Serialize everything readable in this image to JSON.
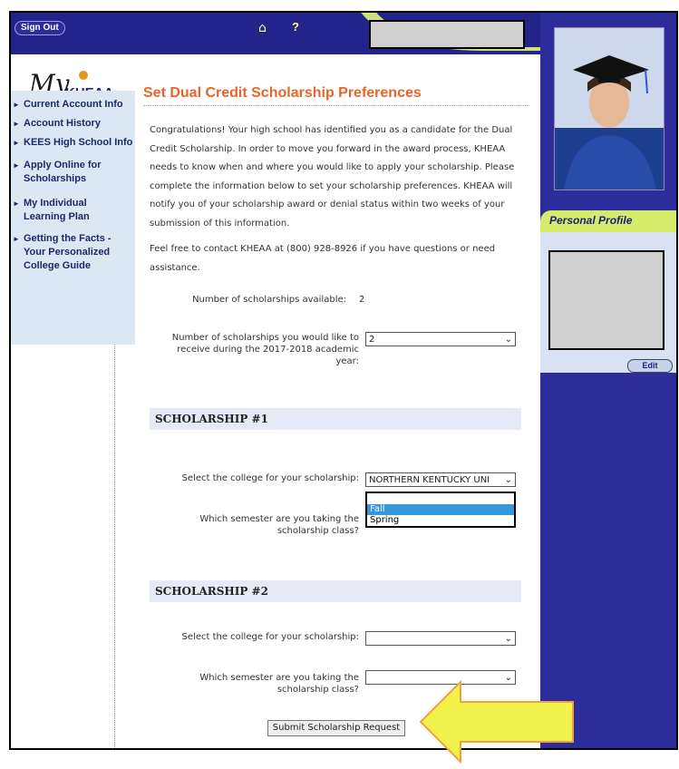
{
  "header": {
    "signout_label": "Sign Out",
    "help_label": "?",
    "home_icon": "home-icon"
  },
  "logo": {
    "text_my": "My",
    "text_kheaa": "KHEAA"
  },
  "nav": {
    "items": [
      {
        "label": "Current Account Info"
      },
      {
        "label": "Account History"
      },
      {
        "label": "KEES High School Info"
      },
      {
        "label": "Apply Online for Scholarships"
      },
      {
        "label": "My Individual Learning Plan"
      },
      {
        "label": "Getting the Facts - Your Personalized College Guide"
      }
    ]
  },
  "main": {
    "title": "Set Dual Credit Scholarship Preferences",
    "intro": "Congratulations! Your high school has identified you as a candidate for the Dual Credit Scholarship. In order to move you forward in the award process, KHEAA needs to know when and where you would like to apply your scholarship. Please complete the information below to set your scholarship preferences. KHEAA will notify you of your scholarship award or denial status within two weeks of your submission of this information.",
    "contact": "Feel free to contact KHEAA at (800) 928-8926 if you have questions or need assistance.",
    "available_label": "Number of scholarships available:",
    "available_value": "2",
    "receive_label": "Number of scholarships you would like to receive during the 2017-2018 academic year:",
    "receive_value": "2",
    "scholarship1": {
      "heading": "SCHOLARSHIP #1",
      "college_label": "Select the college for your scholarship:",
      "college_value": "NORTHERN KENTUCKY UNI",
      "semester_label": "Which semester are you taking the scholarship class?",
      "options": [
        "Fall",
        "Spring"
      ],
      "selected": "Fall"
    },
    "scholarship2": {
      "heading": "SCHOLARSHIP #2",
      "college_label": "Select the college for your scholarship:",
      "college_value": "",
      "semester_label": "Which semester are you taking the scholarship class?",
      "semester_value": ""
    },
    "submit_label": "Submit Scholarship Request"
  },
  "profile": {
    "title": "Personal Profile",
    "edit_label": "Edit"
  },
  "colors": {
    "title_orange": "#e8652a",
    "navy": "#23238c",
    "lime": "#d7eb6a",
    "arrow_yellow": "#f2f24c",
    "arrow_border": "#f2a13a"
  }
}
